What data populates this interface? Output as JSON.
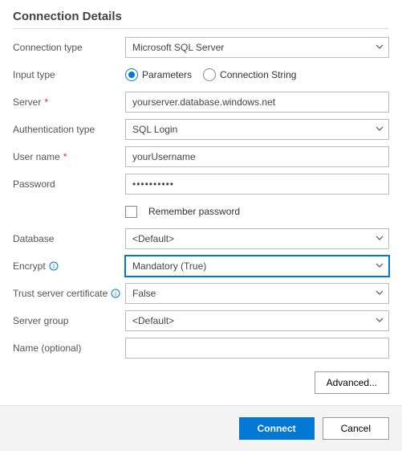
{
  "title": "Connection Details",
  "labels": {
    "connection_type": "Connection type",
    "input_type": "Input type",
    "server": "Server",
    "auth_type": "Authentication type",
    "user_name": "User name",
    "password": "Password",
    "remember": "Remember password",
    "database": "Database",
    "encrypt": "Encrypt",
    "trust_cert": "Trust server certificate",
    "server_group": "Server group",
    "name_opt": "Name (optional)"
  },
  "values": {
    "connection_type": "Microsoft SQL Server",
    "input_type_parameters": "Parameters",
    "input_type_connstr": "Connection String",
    "server": "yourserver.database.windows.net",
    "auth_type": "SQL Login",
    "user_name": "yourUsername",
    "password": "••••••••••",
    "database": "<Default>",
    "encrypt": "Mandatory (True)",
    "trust_cert": "False",
    "server_group": "<Default>",
    "name_opt": ""
  },
  "buttons": {
    "advanced": "Advanced...",
    "connect": "Connect",
    "cancel": "Cancel"
  }
}
